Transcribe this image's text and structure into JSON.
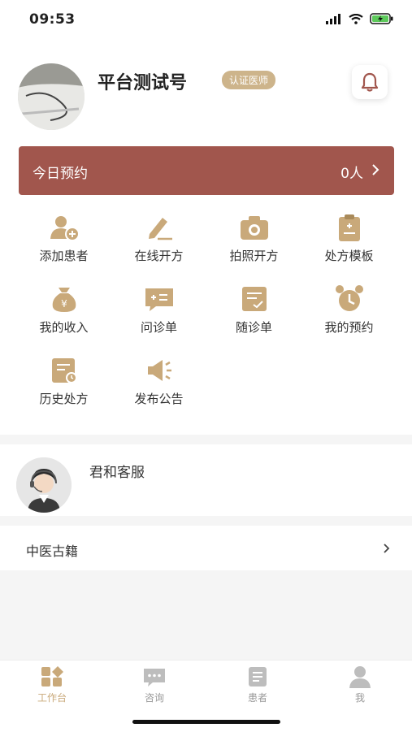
{
  "status_bar": {
    "time": "09:53"
  },
  "profile": {
    "name": "平台测试号",
    "badge": "认证医师"
  },
  "appointment": {
    "label": "今日预约",
    "count": "0人"
  },
  "grid": [
    {
      "label": "添加患者",
      "icon": "add-patient-icon"
    },
    {
      "label": "在线开方",
      "icon": "online-prescription-icon"
    },
    {
      "label": "拍照开方",
      "icon": "camera-icon"
    },
    {
      "label": "处方模板",
      "icon": "clipboard-icon"
    },
    {
      "label": "我的收入",
      "icon": "money-bag-icon"
    },
    {
      "label": "问诊单",
      "icon": "consult-form-icon"
    },
    {
      "label": "随诊单",
      "icon": "followup-form-icon"
    },
    {
      "label": "我的预约",
      "icon": "alarm-clock-icon"
    },
    {
      "label": "历史处方",
      "icon": "history-prescription-icon"
    },
    {
      "label": "发布公告",
      "icon": "megaphone-icon"
    }
  ],
  "customer_service": {
    "name": "君和客服"
  },
  "classics": {
    "label": "中医古籍"
  },
  "tabbar": [
    {
      "label": "工作台",
      "active": true
    },
    {
      "label": "咨询",
      "active": false
    },
    {
      "label": "患者",
      "active": false
    },
    {
      "label": "我",
      "active": false
    }
  ],
  "colors": {
    "accent": "#a1564d",
    "gold": "#c9a97a",
    "badge": "#cdb48b"
  }
}
